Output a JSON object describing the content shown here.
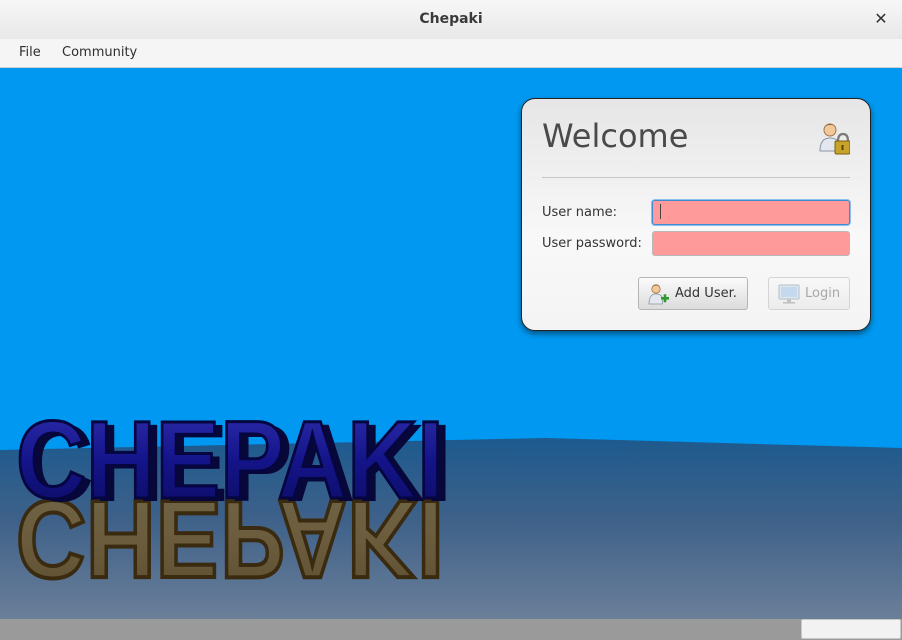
{
  "window": {
    "title": "Chepaki"
  },
  "menu": {
    "items": [
      "File",
      "Community"
    ]
  },
  "scene": {
    "logo_text": "CHEPAKI"
  },
  "login": {
    "heading": "Welcome",
    "username_label": "User name:",
    "password_label": "User password:",
    "username_value": "",
    "password_value": "",
    "add_user_label": "Add User.",
    "login_label": "Login",
    "login_enabled": false,
    "field_color": "#ff9a9a"
  },
  "icons": {
    "close": "close-icon",
    "user_lock": "user-lock-icon",
    "add_user": "user-add-icon",
    "login": "monitor-icon"
  }
}
